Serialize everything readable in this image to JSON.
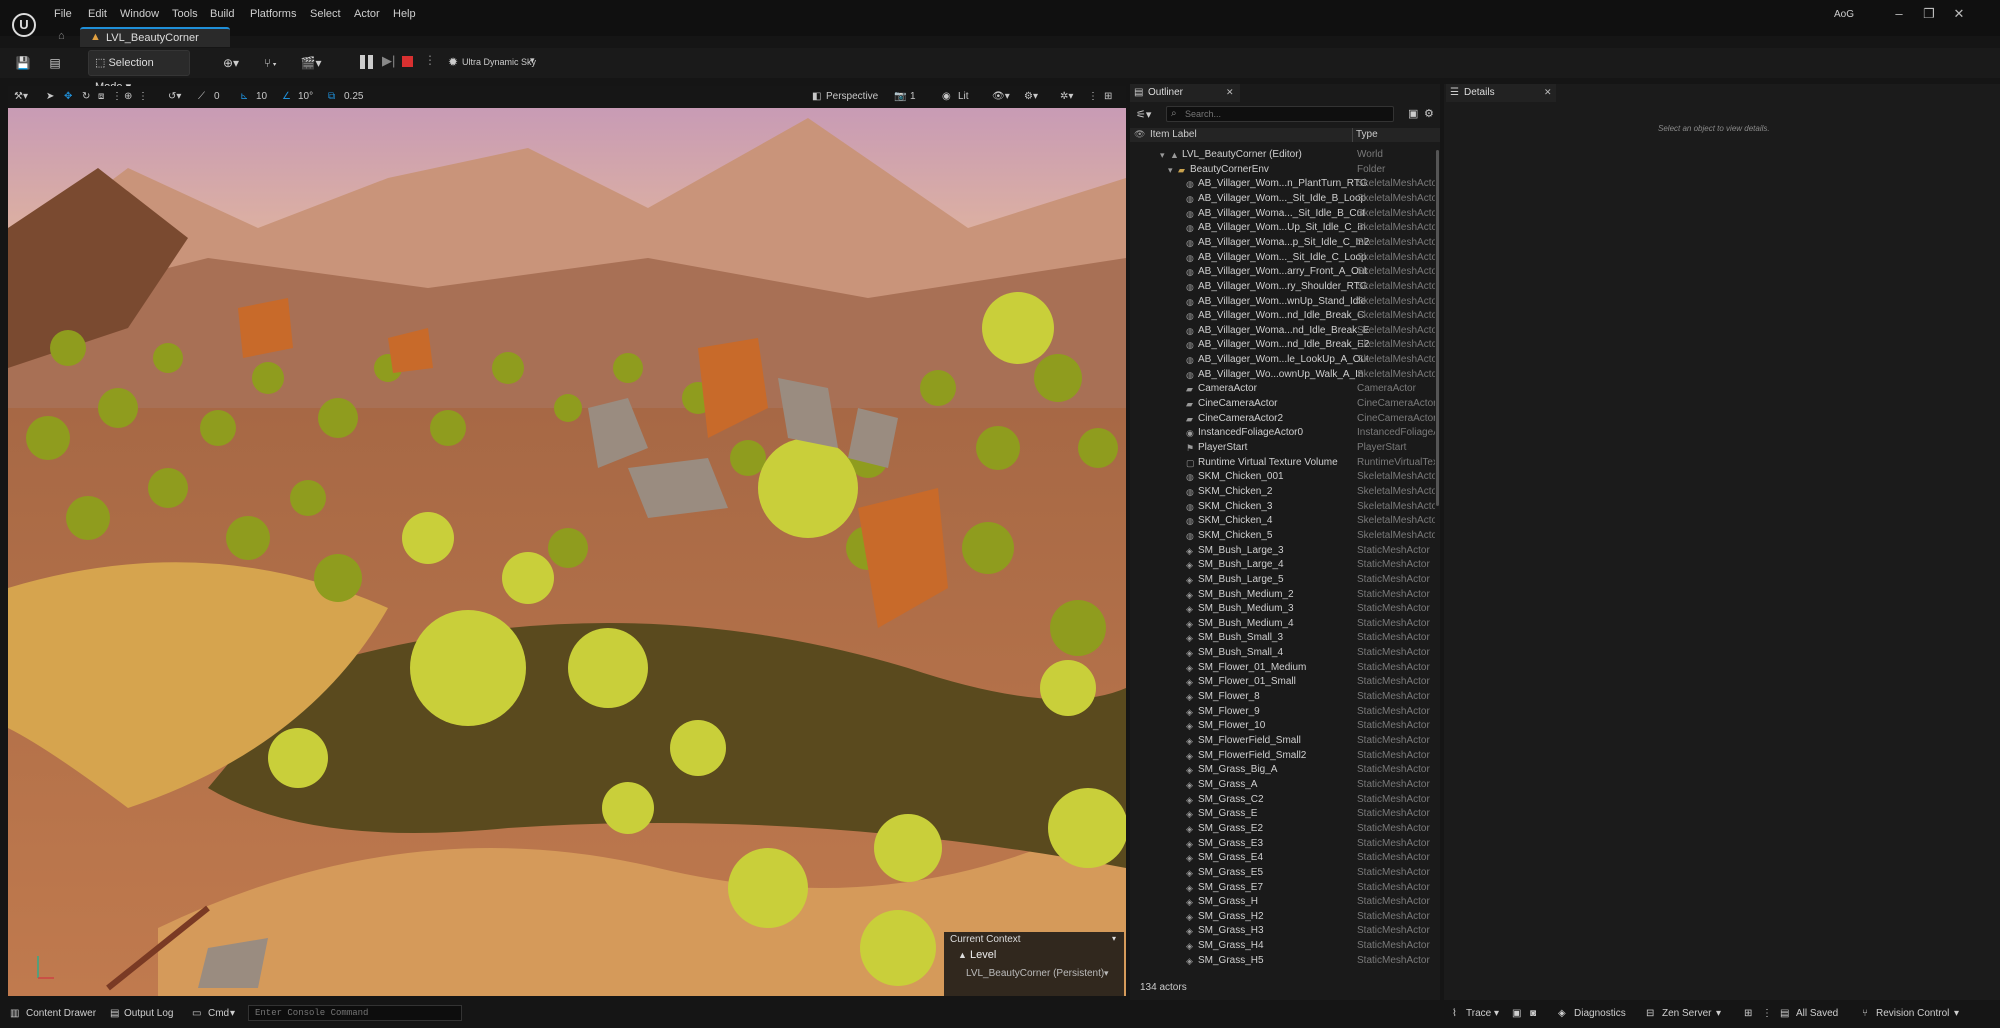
{
  "menu": [
    "File",
    "Edit",
    "Window",
    "Tools",
    "Build",
    "Platforms",
    "Select",
    "Actor",
    "Help"
  ],
  "app": {
    "tab_label": "LVL_BeautyCorner",
    "project": "AoG"
  },
  "toolbar": {
    "mode": "Selection Mode",
    "sky": "Ultra Dynamic Sky"
  },
  "viewport_toolbar": {
    "snap_translate": "0",
    "snap_grid": "10",
    "snap_rot": "10°",
    "snap_scale": "0.25",
    "view": "Perspective",
    "cam_speed": "1",
    "lit": "Lit"
  },
  "context": {
    "title": "Current Context",
    "level_label": "Level",
    "persistent": "LVL_BeautyCorner (Persistent)"
  },
  "outliner": {
    "tab": "Outliner",
    "search_placeholder": "Search...",
    "col_label": "Item Label",
    "col_type": "Type",
    "count": "134 actors",
    "rows": [
      {
        "label": "LVL_BeautyCorner (Editor)",
        "type": "World",
        "indent": 0,
        "icon": "world-icon"
      },
      {
        "label": "BeautyCornerEnv",
        "type": "Folder",
        "indent": 1,
        "icon": "folder-icon"
      },
      {
        "label": "AB_Villager_Wom...n_PlantTurn_RTG",
        "type": "SkeletalMeshActor",
        "indent": 2,
        "icon": "skeletal-icon"
      },
      {
        "label": "AB_Villager_Wom..._Sit_Idle_B_Loop",
        "type": "SkeletalMeshActor",
        "indent": 2,
        "icon": "skeletal-icon"
      },
      {
        "label": "AB_Villager_Woma..._Sit_Idle_B_Cut",
        "type": "SkeletalMeshActor",
        "indent": 2,
        "icon": "skeletal-icon"
      },
      {
        "label": "AB_Villager_Wom...Up_Sit_Idle_C_In",
        "type": "SkeletalMeshActor",
        "indent": 2,
        "icon": "skeletal-icon"
      },
      {
        "label": "AB_Villager_Woma...p_Sit_Idle_C_In2",
        "type": "SkeletalMeshActor",
        "indent": 2,
        "icon": "skeletal-icon"
      },
      {
        "label": "AB_Villager_Wom..._Sit_Idle_C_Loop",
        "type": "SkeletalMeshActor",
        "indent": 2,
        "icon": "skeletal-icon"
      },
      {
        "label": "AB_Villager_Wom...arry_Front_A_Out",
        "type": "SkeletalMeshActor",
        "indent": 2,
        "icon": "skeletal-icon"
      },
      {
        "label": "AB_Villager_Wom...ry_Shoulder_RTG",
        "type": "SkeletalMeshActor",
        "indent": 2,
        "icon": "skeletal-icon"
      },
      {
        "label": "AB_Villager_Wom...wnUp_Stand_Idle",
        "type": "SkeletalMeshActor",
        "indent": 2,
        "icon": "skeletal-icon"
      },
      {
        "label": "AB_Villager_Wom...nd_Idle_Break_C",
        "type": "SkeletalMeshActor",
        "indent": 2,
        "icon": "skeletal-icon"
      },
      {
        "label": "AB_Villager_Woma...nd_Idle_Break_E",
        "type": "SkeletalMeshActor",
        "indent": 2,
        "icon": "skeletal-icon"
      },
      {
        "label": "AB_Villager_Wom...nd_Idle_Break_E2",
        "type": "SkeletalMeshActor",
        "indent": 2,
        "icon": "skeletal-icon"
      },
      {
        "label": "AB_Villager_Wom...le_LookUp_A_Out",
        "type": "SkeletalMeshActor",
        "indent": 2,
        "icon": "skeletal-icon"
      },
      {
        "label": "AB_Villager_Wo...ownUp_Walk_A_In",
        "type": "SkeletalMeshActor",
        "indent": 2,
        "icon": "skeletal-icon"
      },
      {
        "label": "CameraActor",
        "type": "CameraActor",
        "indent": 2,
        "icon": "camera-icon"
      },
      {
        "label": "CineCameraActor",
        "type": "CineCameraActor",
        "indent": 2,
        "icon": "camera-icon"
      },
      {
        "label": "CineCameraActor2",
        "type": "CineCameraActor",
        "indent": 2,
        "icon": "camera-icon"
      },
      {
        "label": "InstancedFoliageActor0",
        "type": "InstancedFoliageActor",
        "indent": 2,
        "icon": "foliage-icon"
      },
      {
        "label": "PlayerStart",
        "type": "PlayerStart",
        "indent": 2,
        "icon": "player-icon"
      },
      {
        "label": "Runtime Virtual Texture Volume",
        "type": "RuntimeVirtualTextureVolume",
        "indent": 2,
        "icon": "volume-icon"
      },
      {
        "label": "SKM_Chicken_001",
        "type": "SkeletalMeshActor",
        "indent": 2,
        "icon": "skeletal-icon"
      },
      {
        "label": "SKM_Chicken_2",
        "type": "SkeletalMeshActor",
        "indent": 2,
        "icon": "skeletal-icon"
      },
      {
        "label": "SKM_Chicken_3",
        "type": "SkeletalMeshActor",
        "indent": 2,
        "icon": "skeletal-icon"
      },
      {
        "label": "SKM_Chicken_4",
        "type": "SkeletalMeshActor",
        "indent": 2,
        "icon": "skeletal-icon"
      },
      {
        "label": "SKM_Chicken_5",
        "type": "SkeletalMeshActor",
        "indent": 2,
        "icon": "skeletal-icon"
      },
      {
        "label": "SM_Bush_Large_3",
        "type": "StaticMeshActor",
        "indent": 2,
        "icon": "static-icon"
      },
      {
        "label": "SM_Bush_Large_4",
        "type": "StaticMeshActor",
        "indent": 2,
        "icon": "static-icon"
      },
      {
        "label": "SM_Bush_Large_5",
        "type": "StaticMeshActor",
        "indent": 2,
        "icon": "static-icon"
      },
      {
        "label": "SM_Bush_Medium_2",
        "type": "StaticMeshActor",
        "indent": 2,
        "icon": "static-icon"
      },
      {
        "label": "SM_Bush_Medium_3",
        "type": "StaticMeshActor",
        "indent": 2,
        "icon": "static-icon"
      },
      {
        "label": "SM_Bush_Medium_4",
        "type": "StaticMeshActor",
        "indent": 2,
        "icon": "static-icon"
      },
      {
        "label": "SM_Bush_Small_3",
        "type": "StaticMeshActor",
        "indent": 2,
        "icon": "static-icon"
      },
      {
        "label": "SM_Bush_Small_4",
        "type": "StaticMeshActor",
        "indent": 2,
        "icon": "static-icon"
      },
      {
        "label": "SM_Flower_01_Medium",
        "type": "StaticMeshActor",
        "indent": 2,
        "icon": "static-icon"
      },
      {
        "label": "SM_Flower_01_Small",
        "type": "StaticMeshActor",
        "indent": 2,
        "icon": "static-icon"
      },
      {
        "label": "SM_Flower_8",
        "type": "StaticMeshActor",
        "indent": 2,
        "icon": "static-icon"
      },
      {
        "label": "SM_Flower_9",
        "type": "StaticMeshActor",
        "indent": 2,
        "icon": "static-icon"
      },
      {
        "label": "SM_Flower_10",
        "type": "StaticMeshActor",
        "indent": 2,
        "icon": "static-icon"
      },
      {
        "label": "SM_FlowerField_Small",
        "type": "StaticMeshActor",
        "indent": 2,
        "icon": "static-icon"
      },
      {
        "label": "SM_FlowerField_Small2",
        "type": "StaticMeshActor",
        "indent": 2,
        "icon": "static-icon"
      },
      {
        "label": "SM_Grass_Big_A",
        "type": "StaticMeshActor",
        "indent": 2,
        "icon": "static-icon"
      },
      {
        "label": "SM_Grass_A",
        "type": "StaticMeshActor",
        "indent": 2,
        "icon": "static-icon"
      },
      {
        "label": "SM_Grass_C2",
        "type": "StaticMeshActor",
        "indent": 2,
        "icon": "static-icon"
      },
      {
        "label": "SM_Grass_E",
        "type": "StaticMeshActor",
        "indent": 2,
        "icon": "static-icon"
      },
      {
        "label": "SM_Grass_E2",
        "type": "StaticMeshActor",
        "indent": 2,
        "icon": "static-icon"
      },
      {
        "label": "SM_Grass_E3",
        "type": "StaticMeshActor",
        "indent": 2,
        "icon": "static-icon"
      },
      {
        "label": "SM_Grass_E4",
        "type": "StaticMeshActor",
        "indent": 2,
        "icon": "static-icon"
      },
      {
        "label": "SM_Grass_E5",
        "type": "StaticMeshActor",
        "indent": 2,
        "icon": "static-icon"
      },
      {
        "label": "SM_Grass_E7",
        "type": "StaticMeshActor",
        "indent": 2,
        "icon": "static-icon"
      },
      {
        "label": "SM_Grass_H",
        "type": "StaticMeshActor",
        "indent": 2,
        "icon": "static-icon"
      },
      {
        "label": "SM_Grass_H2",
        "type": "StaticMeshActor",
        "indent": 2,
        "icon": "static-icon"
      },
      {
        "label": "SM_Grass_H3",
        "type": "StaticMeshActor",
        "indent": 2,
        "icon": "static-icon"
      },
      {
        "label": "SM_Grass_H4",
        "type": "StaticMeshActor",
        "indent": 2,
        "icon": "static-icon"
      },
      {
        "label": "SM_Grass_H5",
        "type": "StaticMeshActor",
        "indent": 2,
        "icon": "static-icon"
      }
    ]
  },
  "details": {
    "tab": "Details",
    "empty_msg": "Select an object to view details."
  },
  "statusbar": {
    "content_drawer": "Content Drawer",
    "output_log": "Output Log",
    "cmd": "Cmd",
    "console_placeholder": "Enter Console Command",
    "trace": "Trace",
    "diagnostics": "Diagnostics",
    "zen": "Zen Server",
    "saved": "All Saved",
    "revision": "Revision Control"
  },
  "colors": {
    "accent": "#1f8fd8",
    "play_stop": "#d83030",
    "background": "#151515"
  }
}
